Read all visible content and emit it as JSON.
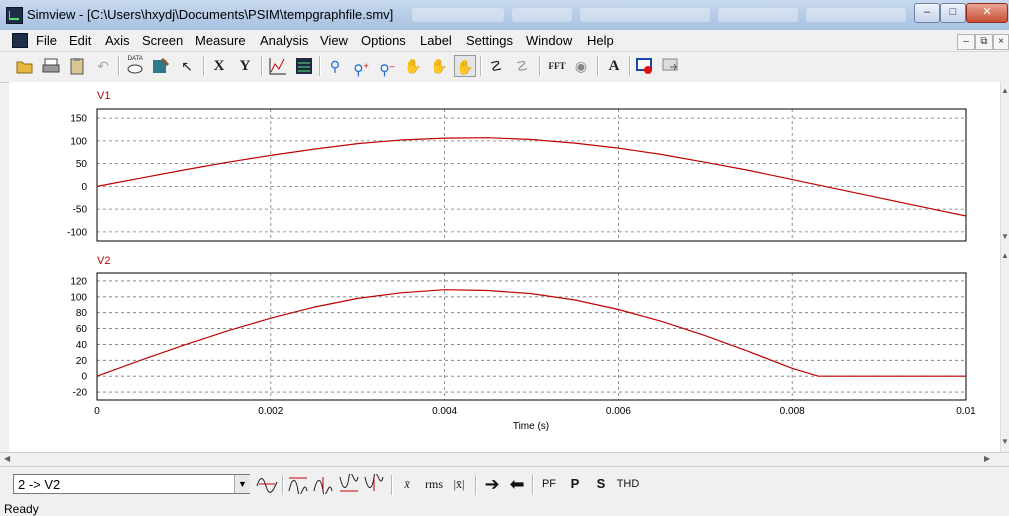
{
  "window": {
    "title": "Simview - [C:\\Users\\hxydj\\Documents\\PSIM\\tempgraphfile.smv]"
  },
  "menu": [
    "File",
    "Edit",
    "Axis",
    "Screen",
    "Measure",
    "Analysis",
    "View",
    "Options",
    "Label",
    "Settings",
    "Window",
    "Help"
  ],
  "toolbar": {
    "data_icon_label": "DATA",
    "x_label": "X",
    "y_label": "Y",
    "fft_label": "FFT",
    "text_label": "A"
  },
  "chart_data": [
    {
      "type": "line",
      "title": "V1",
      "xlim": [
        0,
        0.01
      ],
      "ylim": [
        -120,
        170
      ],
      "yticks": [
        150,
        100,
        50,
        0,
        -50,
        -100
      ],
      "grid": true,
      "series": [
        {
          "name": "V1",
          "color": "#c00000",
          "x": [
            0,
            0.0005,
            0.001,
            0.0015,
            0.002,
            0.0025,
            0.003,
            0.0035,
            0.004,
            0.0045,
            0.005,
            0.0055,
            0.006,
            0.0065,
            0.007,
            0.0075,
            0.008,
            0.0085,
            0.009,
            0.0095,
            0.01
          ],
          "y": [
            0,
            18,
            36,
            53,
            68,
            82,
            94,
            102,
            106,
            107,
            103,
            95,
            84,
            70,
            53,
            35,
            15,
            -5,
            -25,
            -45,
            -65
          ]
        }
      ]
    },
    {
      "type": "line",
      "title": "V2",
      "xlabel": "Time (s)",
      "xlim": [
        0,
        0.01
      ],
      "ylim": [
        -30,
        130
      ],
      "yticks": [
        120,
        100,
        80,
        60,
        40,
        20,
        0,
        -20
      ],
      "xticks": [
        0,
        0.002,
        0.004,
        0.006,
        0.008,
        0.01
      ],
      "xticklabels": [
        "0",
        "0.002",
        "0.004",
        "0.006",
        "0.008",
        "0.01"
      ],
      "grid": true,
      "series": [
        {
          "name": "V2",
          "color": "#c00000",
          "x": [
            0,
            0.0005,
            0.001,
            0.0015,
            0.002,
            0.0025,
            0.003,
            0.0035,
            0.004,
            0.0045,
            0.005,
            0.0055,
            0.006,
            0.0065,
            0.007,
            0.0075,
            0.008,
            0.0083,
            0.0086,
            0.009,
            0.0095,
            0.01
          ],
          "y": [
            0,
            20,
            39,
            57,
            73,
            87,
            98,
            105,
            109,
            108,
            104,
            96,
            84,
            69,
            51,
            31,
            10,
            0,
            0,
            0,
            0,
            0
          ]
        }
      ]
    }
  ],
  "bottom": {
    "curve_select_value": "2 -> V2",
    "rms_label": "rms",
    "pf_label": "PF",
    "p_label": "P",
    "s_label": "S",
    "thd_label": "THD"
  },
  "status": {
    "text": "Ready"
  }
}
